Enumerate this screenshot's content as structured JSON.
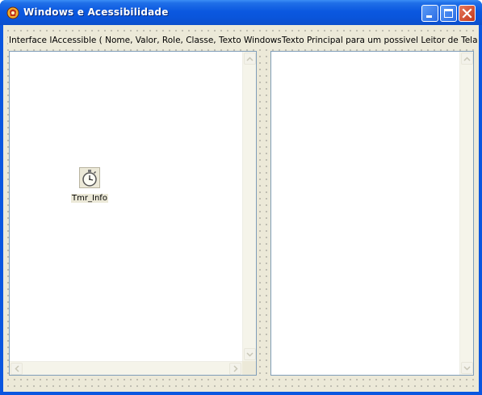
{
  "window": {
    "title": "Windows e Acessibilidade",
    "minimize_label": "Minimize",
    "maximize_label": "Maximize",
    "close_label": "Close"
  },
  "labels": {
    "left": "Interface IAccessible ( Nome, Valor, Role, Classe, Texto Windows)",
    "right": "Texto Principal para um possivel Leitor de Tela"
  },
  "timer_component": {
    "label": "Tmr_Info"
  },
  "icons": {
    "app": "app-icon",
    "minimize": "minimize-icon",
    "maximize": "maximize-icon",
    "close": "close-icon",
    "timer": "stopwatch-icon",
    "scroll_up": "scroll-up-arrow-icon",
    "scroll_down": "scroll-down-arrow-icon",
    "scroll_left": "scroll-left-arrow-icon",
    "scroll_right": "scroll-right-arrow-icon"
  },
  "colors": {
    "titlebar": "#0a56e0",
    "client_bg": "#ece9d8",
    "pane_border": "#7f9db9",
    "close_button": "#c4381a"
  }
}
